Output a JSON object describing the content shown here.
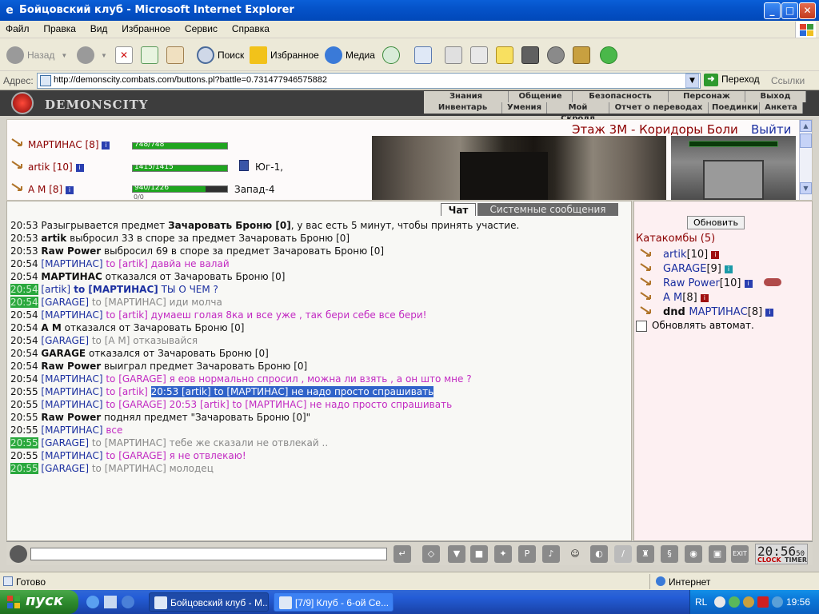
{
  "window": {
    "title": "Бойцовский клуб - Microsoft Internet Explorer",
    "minimize": "_",
    "maximize": "□",
    "close": "✕"
  },
  "menu": [
    "Файл",
    "Правка",
    "Вид",
    "Избранное",
    "Сервис",
    "Справка"
  ],
  "toolbar": {
    "back": "Назад",
    "search": "Поиск",
    "favorites": "Избранное",
    "media": "Медиа"
  },
  "address": {
    "label": "Адрес:",
    "url": "http://demonscity.combats.com/buttons.pl?battle=0.731477946575882",
    "go": "Переход",
    "links": "Ссылки"
  },
  "game": {
    "logo": "DEMONSCITY",
    "nav_top": [
      "Знания",
      "Общение",
      "Безопасность",
      "Персонаж",
      "Выход"
    ],
    "nav_bottom": [
      "Инвентарь",
      "Умения",
      "Мой Скролл",
      "Отчет о переводах",
      "Поединки",
      "Анкета"
    ],
    "floor_title": "Этаж 3М - Коридоры Боли",
    "exit_link": "Выйти",
    "players": [
      {
        "name": "МАРТИНАС",
        "level": "[8]",
        "hp": "748/748",
        "hp_fraction": 1.0,
        "extra": ""
      },
      {
        "name": "artik",
        "level": "[10]",
        "hp": "1415/1415",
        "hp_fraction": 1.0,
        "extra": "Юг-1,"
      },
      {
        "name": "А М",
        "level": "[8]",
        "hp": "940/1226",
        "hp_fraction": 0.767,
        "extra": "Запад-4",
        "mana": "0/0"
      }
    ]
  },
  "chat": {
    "tab_chat": "Чат",
    "tab_system": "Системные сообщения",
    "lines": [
      {
        "time": "20:53",
        "hl": false,
        "parts": [
          {
            "t": "Разыгрывается предмет ",
            "c": ""
          },
          {
            "t": "Зачаровать Броню [0]",
            "c": "bold"
          },
          {
            "t": ", у вас есть 5 минут, чтобы принять участие.",
            "c": ""
          }
        ]
      },
      {
        "time": "20:53",
        "hl": false,
        "parts": [
          {
            "t": "artik",
            "c": "bold"
          },
          {
            "t": " выбросил 33 в споре за предмет Зачаровать Броню [0]",
            "c": ""
          }
        ]
      },
      {
        "time": "20:53",
        "hl": false,
        "parts": [
          {
            "t": "Raw Power",
            "c": "bold"
          },
          {
            "t": " выбросил 69 в споре за предмет Зачаровать Броню [0]",
            "c": ""
          }
        ]
      },
      {
        "time": "20:54",
        "hl": false,
        "parts": [
          {
            "t": "[МАРТИНАС]",
            "c": "cm"
          },
          {
            "t": " to [artik] давйа не валай",
            "c": "pm"
          }
        ]
      },
      {
        "time": "20:54",
        "hl": false,
        "parts": [
          {
            "t": "МАРТИНАС",
            "c": "bold"
          },
          {
            "t": " отказался от Зачаровать Броню [0]",
            "c": ""
          }
        ]
      },
      {
        "time": "20:54",
        "hl": true,
        "parts": [
          {
            "t": "[artik]",
            "c": "cm"
          },
          {
            "t": " to [МАРТИНАС]",
            "c": "cm bold"
          },
          {
            "t": " ТЫ О ЧЕМ ?",
            "c": "cm"
          }
        ]
      },
      {
        "time": "20:54",
        "hl": true,
        "parts": [
          {
            "t": "[GARAGE]",
            "c": "cm"
          },
          {
            "t": " to [МАРТИНАС] иди молча",
            "c": "gray"
          }
        ]
      },
      {
        "time": "20:54",
        "hl": false,
        "parts": [
          {
            "t": "[МАРТИНАС]",
            "c": "cm"
          },
          {
            "t": " to [artik] думаеш голая 8ка и все уже , так бери себе все бери!",
            "c": "pm"
          }
        ]
      },
      {
        "time": "20:54",
        "hl": false,
        "parts": [
          {
            "t": "А М",
            "c": "bold"
          },
          {
            "t": " отказался от Зачаровать Броню [0]",
            "c": ""
          }
        ]
      },
      {
        "time": "20:54",
        "hl": false,
        "parts": [
          {
            "t": "[GARAGE]",
            "c": "cm"
          },
          {
            "t": " to [А М] отказывайся",
            "c": "gray"
          }
        ]
      },
      {
        "time": "20:54",
        "hl": false,
        "parts": [
          {
            "t": "GARAGE",
            "c": "bold"
          },
          {
            "t": " отказался от Зачаровать Броню [0]",
            "c": ""
          }
        ]
      },
      {
        "time": "20:54",
        "hl": false,
        "parts": [
          {
            "t": "Raw Power",
            "c": "bold"
          },
          {
            "t": " выиграл предмет Зачаровать Броню [0]",
            "c": ""
          }
        ]
      },
      {
        "time": "20:54",
        "hl": false,
        "parts": [
          {
            "t": "[МАРТИНАС]",
            "c": "cm"
          },
          {
            "t": " to [GARAGE] я еов нормально спросил , можна ли взять , а он што мне ?",
            "c": "pm"
          }
        ]
      },
      {
        "time": "20:55",
        "hl": false,
        "parts": [
          {
            "t": "[МАРТИНАС]",
            "c": "cm"
          },
          {
            "t": " to [artik] ",
            "c": "pm"
          },
          {
            "t": "20:53 [artik] to [МАРТИНАС] не надо просто спрашивать",
            "c": "sel"
          }
        ]
      },
      {
        "time": "20:55",
        "hl": false,
        "parts": [
          {
            "t": "[МАРТИНАС]",
            "c": "cm"
          },
          {
            "t": " to [GARAGE] 20:53 [artik] to [МАРТИНАС] не надо просто спрашивать",
            "c": "pm"
          }
        ]
      },
      {
        "time": "20:55",
        "hl": false,
        "parts": [
          {
            "t": "Raw Power",
            "c": "bold"
          },
          {
            "t": " поднял предмет \"Зачаровать Броню [0]\"",
            "c": ""
          }
        ]
      },
      {
        "time": "20:55",
        "hl": false,
        "parts": [
          {
            "t": "[МАРТИНАС]",
            "c": "cm"
          },
          {
            "t": " все",
            "c": "pm"
          }
        ]
      },
      {
        "time": "20:55",
        "hl": true,
        "parts": [
          {
            "t": "[GARAGE]",
            "c": "cm"
          },
          {
            "t": " to [МАРТИНАС] тебе же сказали не отвлекай ..",
            "c": "gray"
          }
        ]
      },
      {
        "time": "20:55",
        "hl": false,
        "parts": [
          {
            "t": "[МАРТИНАС]",
            "c": "cm"
          },
          {
            "t": " to [GARAGE] я не отвлекаю!",
            "c": "pm"
          }
        ]
      },
      {
        "time": "20:55",
        "hl": true,
        "parts": [
          {
            "t": "[GARAGE]",
            "c": "cm"
          },
          {
            "t": " to [МАРТИНАС] молодец",
            "c": "gray"
          }
        ]
      }
    ]
  },
  "room": {
    "refresh": "Обновить",
    "title": "Катакомбы (5)",
    "members": [
      {
        "prefix": "",
        "name": "artik",
        "level": "[10]",
        "info": "red"
      },
      {
        "prefix": "",
        "name": "GARAGE",
        "level": "[9]",
        "info": "cyan"
      },
      {
        "prefix": "",
        "name": "Raw Power",
        "level": "[10]",
        "info": "blue"
      },
      {
        "prefix": "",
        "name": "А М",
        "level": "[8]",
        "info": "red"
      },
      {
        "prefix": "dnd ",
        "name": "МАРТИНАС",
        "level": "[8]",
        "info": "blue"
      }
    ],
    "auto_refresh": "Обновлять автомат."
  },
  "bottom": {
    "clock": "20:56",
    "clock_sec": "50",
    "clock_label": "CLOCK",
    "timer_label": "TIMER"
  },
  "status": {
    "text": "Готово",
    "zone": "Интернет"
  },
  "taskbar": {
    "start": "пуск",
    "tasks": [
      "Бойцовский клуб - М...",
      "[7/9] Клуб - 6-ой Се..."
    ],
    "lang": "RL",
    "time": "19:56"
  },
  "colors": {
    "title_bar": "#0553c9",
    "chat_private": "#c22ac2",
    "chat_name": "#1b2fa0",
    "time_highlight": "#2aa83d",
    "selection": "#3063c9"
  }
}
